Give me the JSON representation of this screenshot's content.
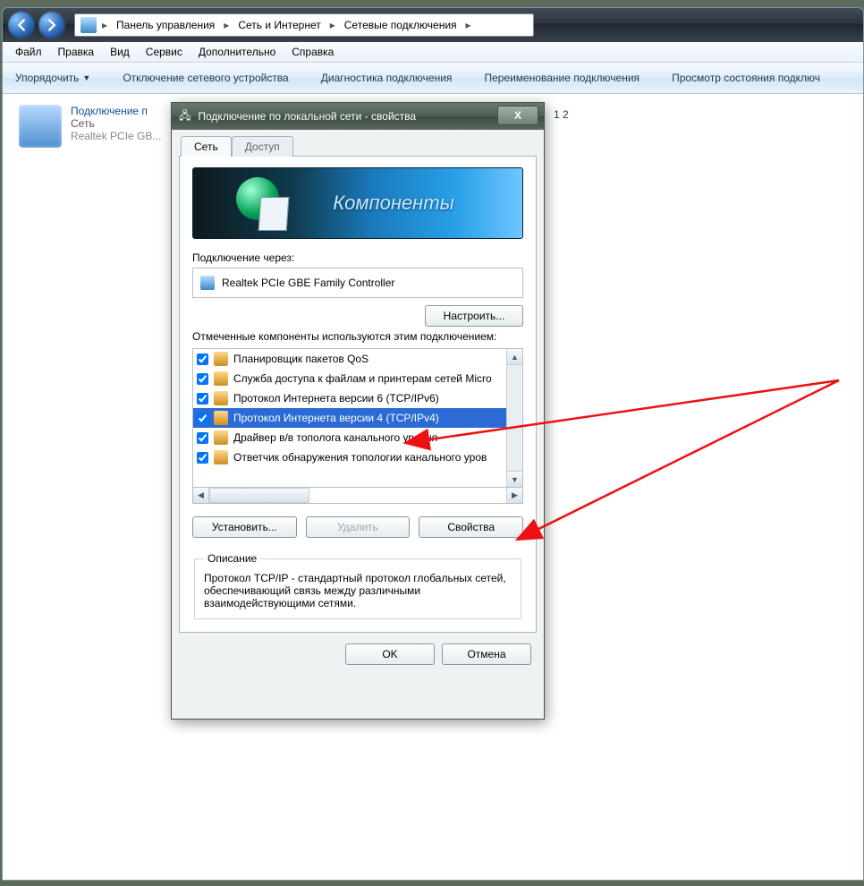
{
  "nav": {
    "back_icon": "back-icon",
    "fwd_icon": "forward-icon",
    "crumbs": [
      "Панель управления",
      "Сеть и Интернет",
      "Сетевые подключения"
    ]
  },
  "menu": {
    "items": [
      "Файл",
      "Правка",
      "Вид",
      "Сервис",
      "Дополнительно",
      "Справка"
    ]
  },
  "cmdbar": {
    "organize": "Упорядочить",
    "disable": "Отключение сетевого устройства",
    "diagnose": "Диагностика подключения",
    "rename": "Переименование подключения",
    "status": "Просмотр состояния подключ"
  },
  "connection_item": {
    "title": "Подключение п",
    "line2": "Сеть",
    "line3": "Realtek PCIe GB...",
    "extra_right": "1 2"
  },
  "dialog": {
    "title": "Подключение по локальной сети - свойства",
    "close": "X",
    "tabs": {
      "network": "Сеть",
      "sharing": "Доступ"
    },
    "banner_text": "Компоненты",
    "connect_using_label": "Подключение через:",
    "adapter": "Realtek PCIe GBE Family Controller",
    "configure_btn": "Настроить...",
    "components_label": "Отмеченные компоненты используются этим подключением:",
    "components": [
      {
        "checked": true,
        "icon": "pkt",
        "label": "Планировщик пакетов QoS",
        "selected": false
      },
      {
        "checked": true,
        "icon": "pkt",
        "label": "Служба доступа к файлам и принтерам сетей Micro",
        "selected": false
      },
      {
        "checked": true,
        "icon": "net",
        "label": "Протокол Интернета версии 6 (TCP/IPv6)",
        "selected": false
      },
      {
        "checked": true,
        "icon": "net",
        "label": "Протокол Интернета версии 4 (TCP/IPv4)",
        "selected": true
      },
      {
        "checked": true,
        "icon": "net",
        "label": "Драйвер в/в тополога канального уровня",
        "selected": false
      },
      {
        "checked": true,
        "icon": "net",
        "label": "Ответчик обнаружения топологии канального уров",
        "selected": false
      }
    ],
    "install_btn": "Установить...",
    "uninstall_btn": "Удалить",
    "properties_btn": "Свойства",
    "desc_legend": "Описание",
    "desc_text": "Протокол TCP/IP - стандартный протокол глобальных сетей, обеспечивающий связь между различными взаимодействующими сетями.",
    "ok": "OK",
    "cancel": "Отмена"
  }
}
